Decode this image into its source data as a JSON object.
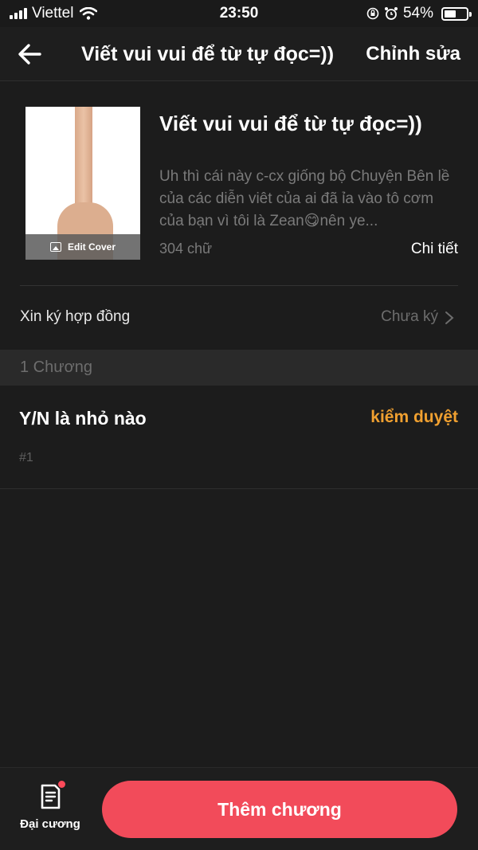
{
  "status_bar": {
    "carrier": "Viettel",
    "time": "23:50",
    "battery": "54%",
    "battery_level": 0.54
  },
  "header": {
    "title": "Viết vui vui để từ tự đọc=))",
    "edit_label": "Chỉnh sửa",
    "back_icon": "back-arrow-icon"
  },
  "book": {
    "cover_button_label": "Edit Cover",
    "title": "Viết vui vui để từ tự đọc=))",
    "description": "Uh thì cái này c-cx giống bộ Chuyện Bên lề của các diễn viêt của ai đã ỉa vào tô cơm của bạn vì tôi là Zean😋nên ye...",
    "word_count": "304 chữ",
    "detail_label": "Chi tiết"
  },
  "contract": {
    "label": "Xin ký hợp đồng",
    "value": "Chưa ký"
  },
  "chapters": {
    "count_label": "1 Chương",
    "items": [
      {
        "name": "Y/N là nhỏ nào",
        "status": "kiểm duyệt",
        "number": "#1"
      }
    ]
  },
  "bottom_bar": {
    "outline_label": "Đại cương",
    "add_chapter_label": "Thêm chương"
  },
  "colors": {
    "background": "#1c1c1c",
    "accent": "#f24b5a",
    "review_status": "#f0a030"
  }
}
